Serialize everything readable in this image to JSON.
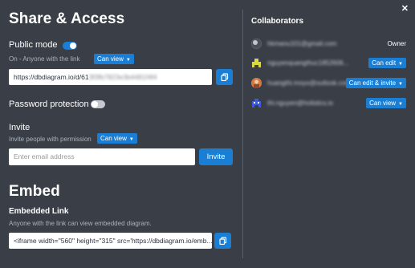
{
  "share": {
    "title": "Share & Access",
    "public_mode_label": "Public mode",
    "public_mode_on": true,
    "public_mode_desc": "On - Anyone with the link",
    "public_perm": "Can view",
    "link_value": "https://dbdiagram.io/d/61",
    "link_blurred": "3f3fb7823e3b4481f4f4",
    "password_label": "Password protection",
    "password_on": false,
    "invite_label": "Invite",
    "invite_desc": "Invite people with permission",
    "invite_perm": "Can view",
    "email_placeholder": "Enter email address",
    "invite_button": "Invite"
  },
  "embed": {
    "title": "Embed",
    "link_label": "Embedded Link",
    "link_desc": "Anyone with the link can view embedded diagram.",
    "iframe_value": "<iframe width=\"560\" height=\"315\" src='https://dbdiagram.io/emb..."
  },
  "collaborators": {
    "title": "Collaborators",
    "items": [
      {
        "email": "hkmanu101@gmail.com",
        "role": "Owner",
        "is_owner": true,
        "avatar_color": "#6b7078"
      },
      {
        "email": "nguyenquangthuc1852606...",
        "role": "Can edit",
        "is_owner": false,
        "avatar_color": "#d9d93a"
      },
      {
        "email": "huangthi.moyo@outlook.com",
        "role": "Can edit & invite",
        "is_owner": false,
        "avatar_color": "#e07a3a"
      },
      {
        "email": "thi.nguyen@holistics.io",
        "role": "Can view",
        "is_owner": false,
        "avatar_color": "#3a5ad9"
      }
    ]
  },
  "close_icon": "close-icon",
  "accent_color": "#1a7fd4"
}
